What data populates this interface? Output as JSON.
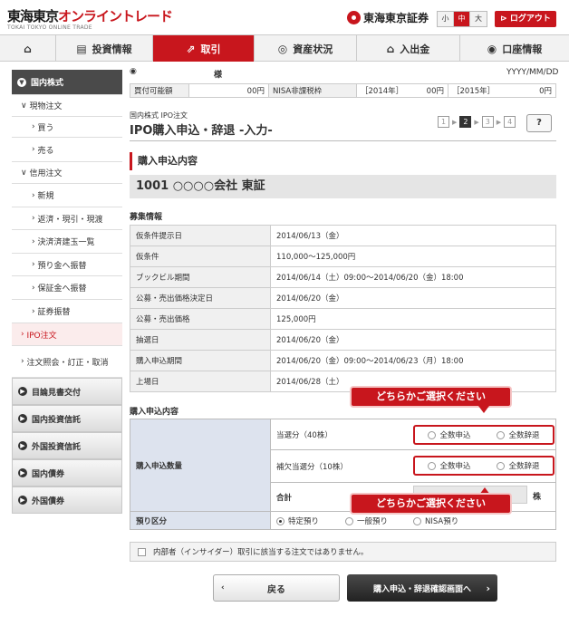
{
  "header": {
    "logo_black": "東海東京",
    "logo_red": "オンライントレード",
    "logo_sub": "TOKAI TOKYO ONLINE TRADE",
    "brand": "東海東京証券",
    "font_sizes": [
      "小",
      "中",
      "大"
    ],
    "font_size_selected": "中",
    "logout": "ログアウト"
  },
  "nav": [
    {
      "label": "",
      "icon": "home-icon"
    },
    {
      "label": "投資情報",
      "icon": "info-icon"
    },
    {
      "label": "取引",
      "icon": "trade-icon"
    },
    {
      "label": "資産状況",
      "icon": "coins-icon"
    },
    {
      "label": "入出金",
      "icon": "bank-icon"
    },
    {
      "label": "口座情報",
      "icon": "person-icon"
    }
  ],
  "sidebar": {
    "head": "国内株式",
    "spot": "現物注文",
    "buy": "買う",
    "sell": "売る",
    "margin": "信用注文",
    "new": "新規",
    "repay": "返済・現引・現渡",
    "settled": "決済済建玉一覧",
    "to_deposit": "預り金へ振替",
    "to_margin": "保証金へ振替",
    "securities_transfer": "証券振替",
    "ipo": "IPO注文",
    "inquiry": "注文照会・訂正・取消",
    "cat1": "目論見書交付",
    "cat2": "国内投資信託",
    "cat3": "外国投資信託",
    "cat4": "国内債券",
    "cat5": "外国債券"
  },
  "user": {
    "name_suffix": "様",
    "date": "YYYY/MM/DD"
  },
  "funds": {
    "available_label": "買付可能額",
    "available_value": "00円",
    "nisa_label": "NISA非課税枠",
    "nisa_2014_label": "［2014年］",
    "nisa_2014_value": "00円",
    "nisa_2015_label": "［2015年］",
    "nisa_2015_value": "0円"
  },
  "page": {
    "breadcrumb": "国内株式 IPO注文",
    "title": "IPO購入申込・辞退 -入力-",
    "steps": [
      "1",
      "2",
      "3",
      "4"
    ],
    "current_step": "2",
    "help": "?"
  },
  "section_title": "購入申込内容",
  "stock": "1001 ○○○○会社 東証",
  "recruit": {
    "heading": "募集情報",
    "rows": [
      {
        "label": "仮条件提示日",
        "value": "2014/06/13（金）"
      },
      {
        "label": "仮条件",
        "value": "110,000～125,000円"
      },
      {
        "label": "ブックビル期間",
        "value": "2014/06/14（土）09:00～2014/06/20（金）18:00"
      },
      {
        "label": "公募・売出価格決定日",
        "value": "2014/06/20（金）"
      },
      {
        "label": "公募・売出価格",
        "value": "125,000円"
      },
      {
        "label": "抽選日",
        "value": "2014/06/20（金）"
      },
      {
        "label": "購入申込期間",
        "value": "2014/06/20（金）09:00～2014/06/23（月）18:00"
      },
      {
        "label": "上場日",
        "value": "2014/06/28（土）"
      }
    ]
  },
  "order": {
    "heading": "購入申込内容",
    "qty_label": "購入申込数量",
    "win_label": "当選分（40株）",
    "sub_label": "補欠当選分（10株）",
    "opt_all_apply": "全数申込",
    "opt_all_decline": "全数辞退",
    "total_label": "合計",
    "total_unit": "株",
    "custody_label": "預り区分",
    "custody_options": [
      "特定預り",
      "一般預り",
      "NISA預り"
    ],
    "custody_selected": "特定預り",
    "callout": "どちらかご選択ください"
  },
  "insider_text": "内部者（インサイダー）取引に該当する注文ではありません。",
  "buttons": {
    "back": "戻る",
    "next": "購入申込・辞退確認画面へ"
  },
  "colors": {
    "accent": "#c8161d",
    "dark": "#333333"
  }
}
